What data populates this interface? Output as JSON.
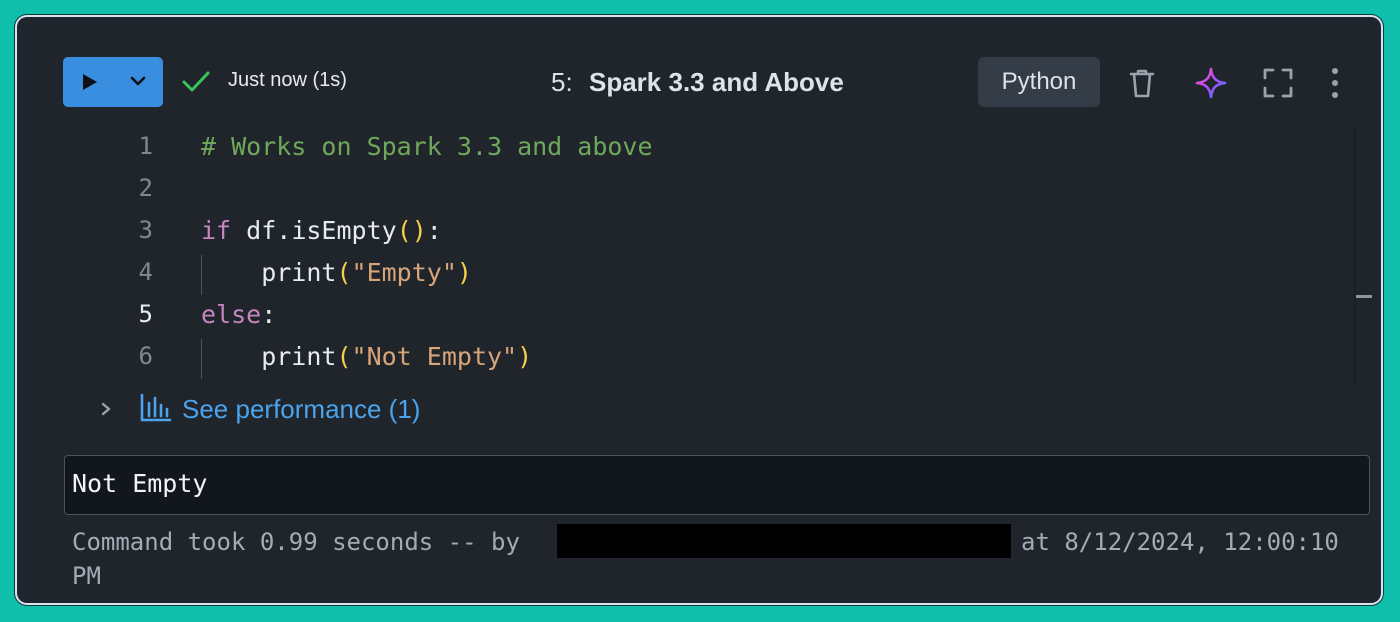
{
  "header": {
    "status_text": "Just now (1s)",
    "cell_number": "5:",
    "cell_title": "Spark 3.3 and Above",
    "language": "Python",
    "icons": [
      "play-icon",
      "chevron-down-icon",
      "check-icon",
      "trash-icon",
      "sparkle-icon",
      "expand-icon",
      "more-vertical-icon"
    ],
    "accent_color": "#3a8ee0",
    "status_color": "#34c759"
  },
  "editor": {
    "line_numbers": [
      "1",
      "2",
      "3",
      "4",
      "5",
      "6"
    ],
    "active_line": "5",
    "lines": [
      {
        "segments": [
          {
            "text": "# Works on Spark 3.3 and above",
            "kind": "comment"
          }
        ]
      },
      {
        "segments": []
      },
      {
        "segments": [
          {
            "text": "if",
            "kind": "kw"
          },
          {
            "text": " df.isEmpty",
            "kind": "plain"
          },
          {
            "text": "()",
            "kind": "paren"
          },
          {
            "text": ":",
            "kind": "plain"
          }
        ]
      },
      {
        "segments": [
          {
            "text": "    print",
            "kind": "plain"
          },
          {
            "text": "(",
            "kind": "paren"
          },
          {
            "text": "\"Empty\"",
            "kind": "str"
          },
          {
            "text": ")",
            "kind": "paren"
          }
        ]
      },
      {
        "segments": [
          {
            "text": "else",
            "kind": "kw"
          },
          {
            "text": ":",
            "kind": "plain"
          }
        ]
      },
      {
        "segments": [
          {
            "text": "    print",
            "kind": "plain"
          },
          {
            "text": "(",
            "kind": "paren"
          },
          {
            "text": "\"Not Empty\"",
            "kind": "str"
          },
          {
            "text": ")",
            "kind": "paren"
          }
        ]
      }
    ]
  },
  "performance": {
    "label": "See performance (1)"
  },
  "output": {
    "text": "Not Empty",
    "command_prefix": "Command took 0.99 seconds -- by",
    "command_suffix": "at 8/12/2024, 12:00:10",
    "command_wrap": "PM"
  }
}
